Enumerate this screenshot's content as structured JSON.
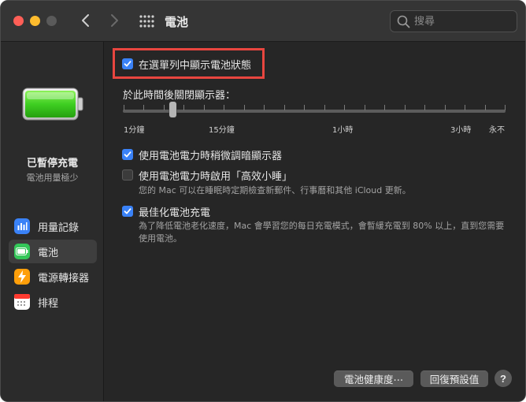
{
  "window": {
    "title": "電池"
  },
  "search": {
    "placeholder": "搜尋"
  },
  "sidebar": {
    "status_title": "已暫停充電",
    "status_subtitle": "電池用量極少",
    "items": [
      {
        "label": "用量記錄",
        "icon": "bar-chart-icon",
        "color": "#3a82f7",
        "active": false
      },
      {
        "label": "電池",
        "icon": "battery-icon",
        "color": "#34c759",
        "active": true
      },
      {
        "label": "電源轉接器",
        "icon": "lightning-bolt-icon",
        "color": "#ff9f0a",
        "active": false
      },
      {
        "label": "排程",
        "icon": "calendar-icon",
        "color": "#ffffff",
        "active": false
      }
    ]
  },
  "main": {
    "show_in_menu_bar": {
      "label": "在選單列中顯示電池狀態",
      "checked": true
    },
    "display_off": {
      "label": "於此時間後關閉顯示器：",
      "tick_labels": [
        "1分鐘",
        "15分鐘",
        "1小時",
        "3小時",
        "永不"
      ]
    },
    "dim_display": {
      "label": "使用電池電力時稍微調暗顯示器",
      "checked": true
    },
    "power_nap": {
      "label": "使用電池電力時啟用「高效小睡」",
      "checked": false,
      "description": "您的 Mac 可以在睡眠時定期檢查新郵件、行事曆和其他 iCloud 更新。"
    },
    "optimized_charging": {
      "label": "最佳化電池充電",
      "checked": true,
      "description": "為了降低電池老化速度，Mac 會學習您的每日充電模式，會暫緩充電到 80% 以上，直到您需要使用電池。"
    }
  },
  "buttons": {
    "battery_health": "電池健康度⋯",
    "restore_defaults": "回復預設值",
    "help": "?"
  },
  "colors": {
    "accent": "#3a82f7",
    "highlight": "#e8463f",
    "battery_green": "#34c759"
  }
}
